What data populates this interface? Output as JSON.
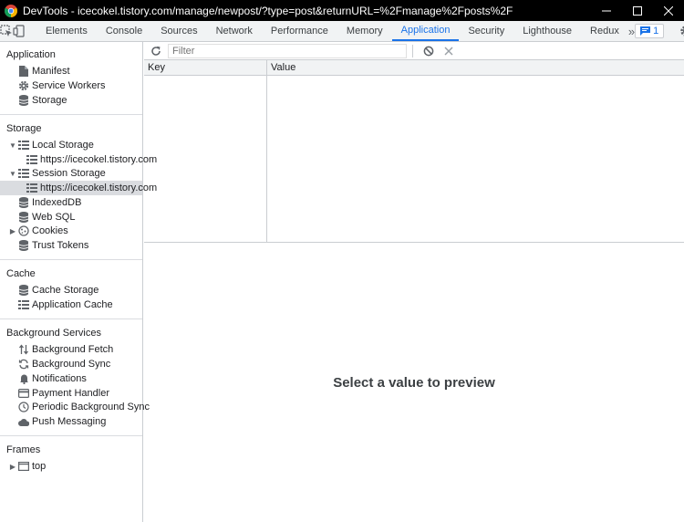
{
  "window": {
    "title": "DevTools - icecokel.tistory.com/manage/newpost/?type=post&returnURL=%2Fmanage%2Fposts%2F"
  },
  "tabs": [
    {
      "label": "Elements"
    },
    {
      "label": "Console"
    },
    {
      "label": "Sources"
    },
    {
      "label": "Network"
    },
    {
      "label": "Performance"
    },
    {
      "label": "Memory"
    },
    {
      "label": "Application",
      "active": true
    },
    {
      "label": "Security"
    },
    {
      "label": "Lighthouse"
    },
    {
      "label": "Redux"
    }
  ],
  "issues": {
    "count": "1"
  },
  "sidebar": {
    "application": {
      "header": "Application",
      "items": [
        {
          "label": "Manifest",
          "icon": "document-icon"
        },
        {
          "label": "Service Workers",
          "icon": "gear-icon"
        },
        {
          "label": "Storage",
          "icon": "database-icon"
        }
      ]
    },
    "storage": {
      "header": "Storage",
      "local_storage": {
        "label": "Local Storage",
        "child": "https://icecokel.tistory.com"
      },
      "session_storage": {
        "label": "Session Storage",
        "child": "https://icecokel.tistory.com"
      },
      "items": [
        {
          "label": "IndexedDB",
          "icon": "database-icon"
        },
        {
          "label": "Web SQL",
          "icon": "database-icon"
        },
        {
          "label": "Cookies",
          "icon": "cookie-icon"
        },
        {
          "label": "Trust Tokens",
          "icon": "database-icon"
        }
      ]
    },
    "cache": {
      "header": "Cache",
      "items": [
        {
          "label": "Cache Storage",
          "icon": "database-icon"
        },
        {
          "label": "Application Cache",
          "icon": "grid-icon"
        }
      ]
    },
    "background": {
      "header": "Background Services",
      "items": [
        {
          "label": "Background Fetch",
          "icon": "arrows-updown-icon"
        },
        {
          "label": "Background Sync",
          "icon": "sync-icon"
        },
        {
          "label": "Notifications",
          "icon": "bell-icon"
        },
        {
          "label": "Payment Handler",
          "icon": "card-icon"
        },
        {
          "label": "Periodic Background Sync",
          "icon": "clock-icon"
        },
        {
          "label": "Push Messaging",
          "icon": "cloud-icon"
        }
      ]
    },
    "frames": {
      "header": "Frames",
      "items": [
        {
          "label": "top",
          "icon": "frame-icon"
        }
      ]
    }
  },
  "main": {
    "filter_placeholder": "Filter",
    "columns": {
      "key": "Key",
      "value": "Value"
    },
    "preview_message": "Select a value to preview"
  },
  "colors": {
    "accent": "#1a73e8",
    "titlebar": "#000000",
    "toolbar_bg": "#f1f3f4",
    "selected_bg": "#dadce0"
  }
}
